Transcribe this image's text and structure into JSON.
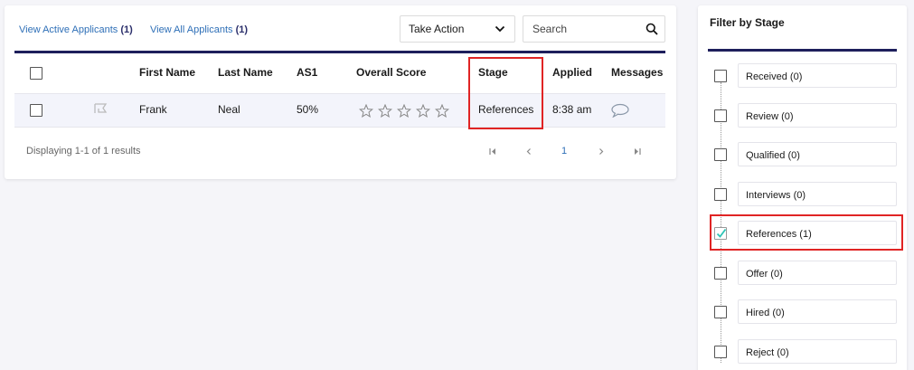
{
  "links": {
    "active": {
      "label": "View Active Applicants",
      "count": "(1)"
    },
    "all": {
      "label": "View All Applicants",
      "count": "(1)"
    }
  },
  "toolbar": {
    "take_action": "Take Action",
    "search_placeholder": "Search"
  },
  "table": {
    "columns": [
      "First Name",
      "Last Name",
      "AS1",
      "Overall Score",
      "Stage",
      "Applied",
      "Messages"
    ],
    "rows": [
      {
        "first_name": "Frank",
        "last_name": "Neal",
        "as1": "50%",
        "overall_score_stars": 0,
        "stage": "References",
        "applied": "8:38 am"
      }
    ]
  },
  "footer": {
    "results": "Displaying 1-1 of 1 results",
    "current_page": "1"
  },
  "filter": {
    "title": "Filter by Stage",
    "stages": [
      {
        "label": "Received (0)",
        "checked": false
      },
      {
        "label": "Review (0)",
        "checked": false
      },
      {
        "label": "Qualified (0)",
        "checked": false
      },
      {
        "label": "Interviews (0)",
        "checked": false
      },
      {
        "label": "References (1)",
        "checked": true
      },
      {
        "label": "Offer (0)",
        "checked": false
      },
      {
        "label": "Hired (0)",
        "checked": false
      },
      {
        "label": "Reject (0)",
        "checked": false
      }
    ]
  },
  "colors": {
    "navy_rule": "#1e1f5c",
    "link": "#2e6fb7",
    "highlight": "#e02424",
    "check": "#2ec4b6"
  }
}
